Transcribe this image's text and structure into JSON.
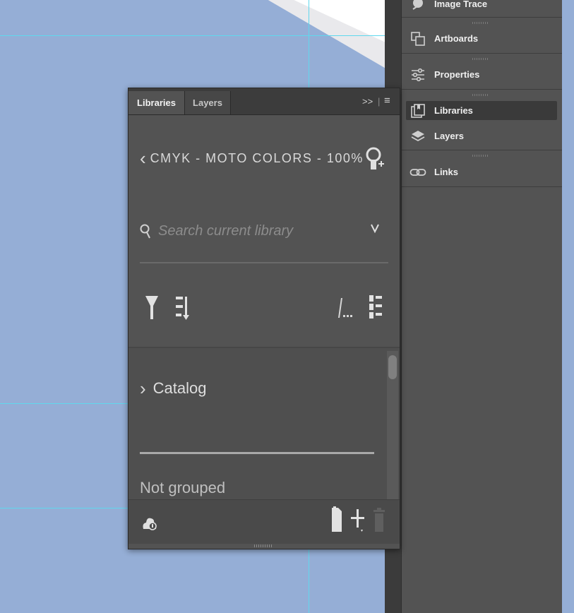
{
  "colors": {
    "canvas": "#95aed6",
    "guide": "#5fd8ee",
    "panel_bg": "#535353",
    "tabbar_bg": "#3c3c3c",
    "text": "#f0f0f0"
  },
  "dock": {
    "items": [
      {
        "label": "Image Trace",
        "icon": "image-trace-icon"
      },
      {
        "label": "Artboards",
        "icon": "artboards-icon"
      },
      {
        "label": "Properties",
        "icon": "properties-icon"
      },
      {
        "label": "Libraries",
        "icon": "libraries-icon",
        "active": true
      },
      {
        "label": "Layers",
        "icon": "layers-icon"
      },
      {
        "label": "Links",
        "icon": "links-icon"
      }
    ]
  },
  "panel": {
    "tabs": [
      {
        "label": "Libraries",
        "active": true
      },
      {
        "label": "Layers",
        "active": false
      }
    ],
    "collapse_glyph": ">>",
    "menu_glyph": "≡",
    "library_title": "CMYK - MOTO COLORS - 100%",
    "back_glyph": "‹",
    "search": {
      "placeholder": "Search current library",
      "value": ""
    },
    "toolbar": {
      "filter_icon": "filter-icon",
      "sort_icon": "sort-icon",
      "view_icon": "grid-view-icon",
      "list_icon": "list-view-icon"
    },
    "groups": [
      {
        "label": "Catalog",
        "expander": "›"
      },
      {
        "label": "Not grouped"
      }
    ],
    "footer": {
      "cloud_icon": "cloud-sync-icon",
      "new_group_icon": "new-folder-icon",
      "add_icon": "add-icon",
      "delete_icon": "trash-icon"
    }
  }
}
